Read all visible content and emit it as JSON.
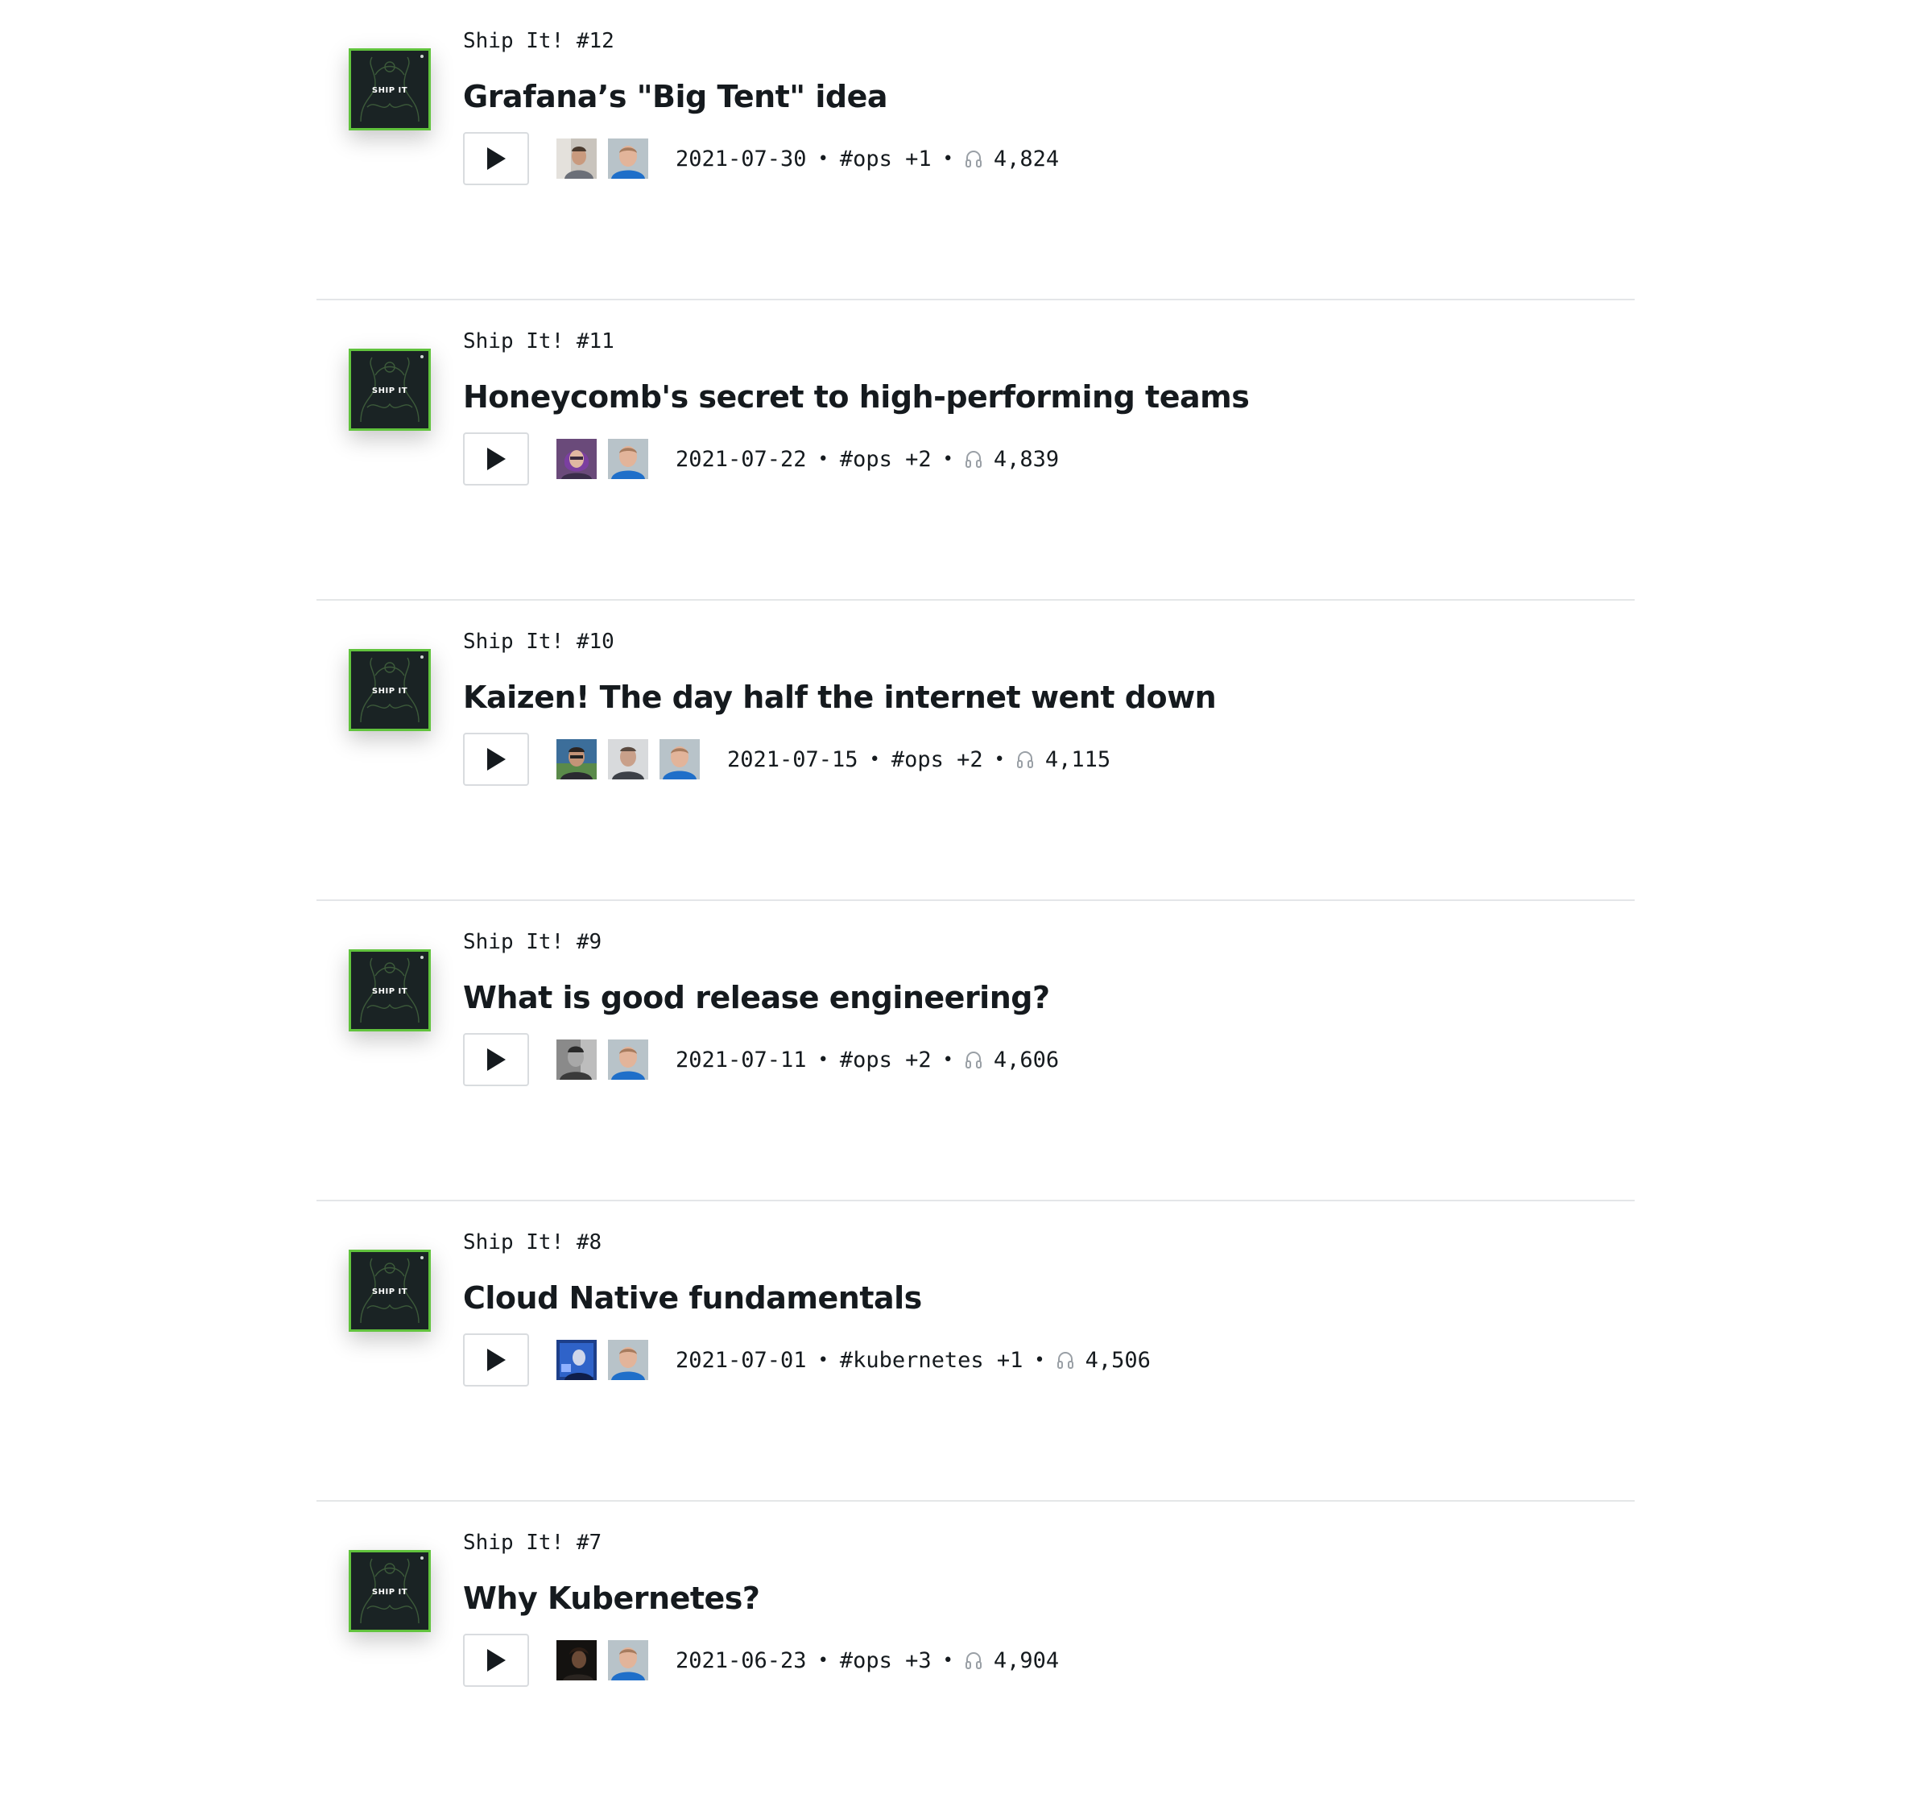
{
  "episodes": [
    {
      "podcast": "Ship It! #12",
      "title": "Grafana’s \"Big Tent\" idea",
      "date": "2021-07-30",
      "topics": "#ops +1",
      "plays": "4,824",
      "cover_label": "SHIP IT",
      "avatars": [
        "guest-avatar",
        "host-avatar"
      ]
    },
    {
      "podcast": "Ship It! #11",
      "title": "Honeycomb's secret to high-performing teams",
      "date": "2021-07-22",
      "topics": "#ops +2",
      "plays": "4,839",
      "cover_label": "SHIP IT",
      "avatars": [
        "guest-avatar",
        "host-avatar"
      ]
    },
    {
      "podcast": "Ship It! #10",
      "title": "Kaizen! The day half the internet went down",
      "date": "2021-07-15",
      "topics": "#ops +2",
      "plays": "4,115",
      "cover_label": "SHIP IT",
      "avatars": [
        "guest-avatar",
        "guest-avatar",
        "host-avatar"
      ]
    },
    {
      "podcast": "Ship It! #9",
      "title": "What is good release engineering?",
      "date": "2021-07-11",
      "topics": "#ops +2",
      "plays": "4,606",
      "cover_label": "SHIP IT",
      "avatars": [
        "guest-avatar",
        "host-avatar"
      ]
    },
    {
      "podcast": "Ship It! #8",
      "title": "Cloud Native fundamentals",
      "date": "2021-07-01",
      "topics": "#kubernetes +1",
      "plays": "4,506",
      "cover_label": "SHIP IT",
      "avatars": [
        "guest-avatar",
        "host-avatar"
      ]
    },
    {
      "podcast": "Ship It! #7",
      "title": "Why Kubernetes?",
      "date": "2021-06-23",
      "topics": "#ops +3",
      "plays": "4,904",
      "cover_label": "SHIP IT",
      "avatars": [
        "guest-avatar",
        "host-avatar"
      ]
    }
  ],
  "separator": "•",
  "icons": {
    "play": "play-icon",
    "plays": "headphones-icon"
  },
  "colors": {
    "cover_background": "#1a2324",
    "cover_accent": "#61c33d",
    "text": "#151a1e",
    "divider": "#e4e6e8"
  }
}
